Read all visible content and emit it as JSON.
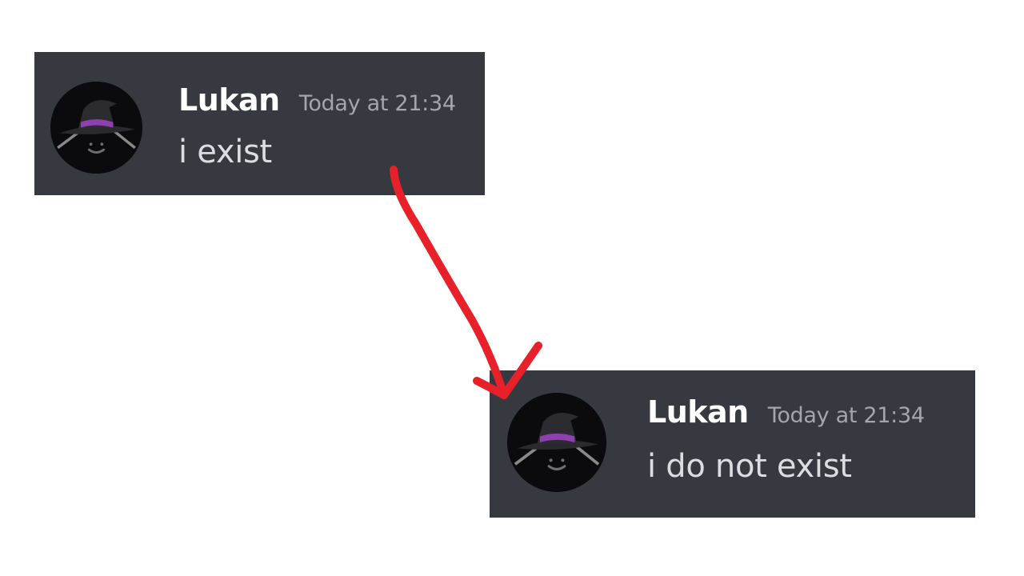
{
  "messages": [
    {
      "username": "Lukan",
      "timestamp": "Today at 21:34",
      "content": "i exist"
    },
    {
      "username": "Lukan",
      "timestamp": "Today at 21:34",
      "content": "i do not exist"
    }
  ],
  "colors": {
    "page_background": "#ffffff",
    "card_background": "#36393f",
    "username": "#ffffff",
    "timestamp": "#a3a6aa",
    "content": "#dcddde",
    "arrow": "#e8202a",
    "hat_band": "#8e3fb0"
  },
  "icons": {
    "avatar": "witch-hat-face-icon",
    "annotation": "hand-drawn-arrow-icon"
  }
}
